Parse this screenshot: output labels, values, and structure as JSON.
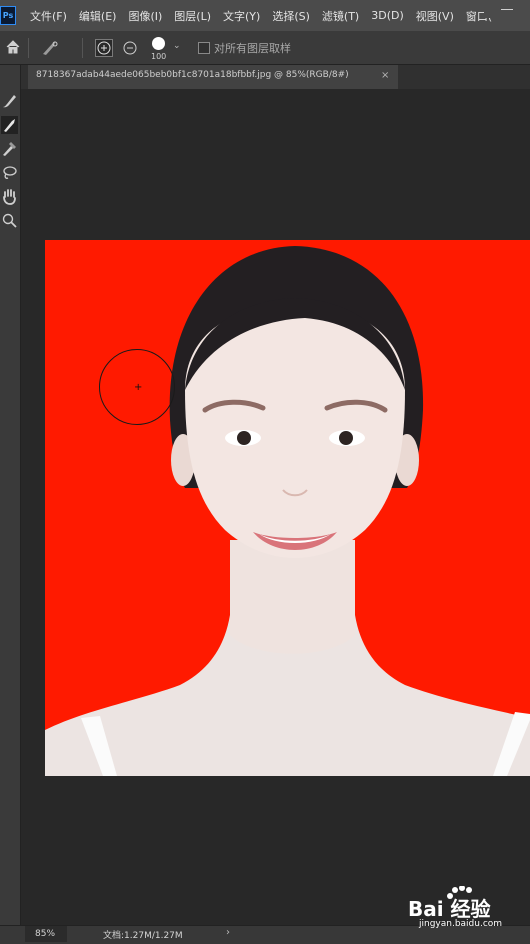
{
  "app": {
    "logo_text": "Ps"
  },
  "menu": {
    "items": [
      "文件(F)",
      "编辑(E)",
      "图像(I)",
      "图层(L)",
      "文字(Y)",
      "选择(S)",
      "滤镜(T)",
      "3D(D)",
      "视图(V)",
      "窗口("
    ]
  },
  "options": {
    "brush_size": "100",
    "sample_all_layers_label": "对所有图层取样",
    "sample_all_layers_checked": false
  },
  "document": {
    "tab_title": "8718367adab44aede065beb0bf1c8701a18bfbbf.jpg @ 85%(RGB/8#)",
    "tab_close": "×"
  },
  "canvas": {
    "background_color": "#ff1a00",
    "brush_cursor_cross": "+"
  },
  "status": {
    "zoom": "85%",
    "doc_info": "文档:1.27M/1.27M",
    "arrow": "›"
  },
  "watermark": {
    "brand_text": "Bai 经验",
    "url": "jingyan.baidu.com"
  },
  "icons": [
    "home-icon",
    "quick-selection-brush-icon",
    "add-to-selection-icon",
    "subtract-from-selection-icon",
    "chevron-down-icon",
    "search-icon",
    "brush-icon",
    "mixer-brush-icon",
    "lasso-icon",
    "hand-icon",
    "zoom-icon",
    "paw-icon"
  ]
}
